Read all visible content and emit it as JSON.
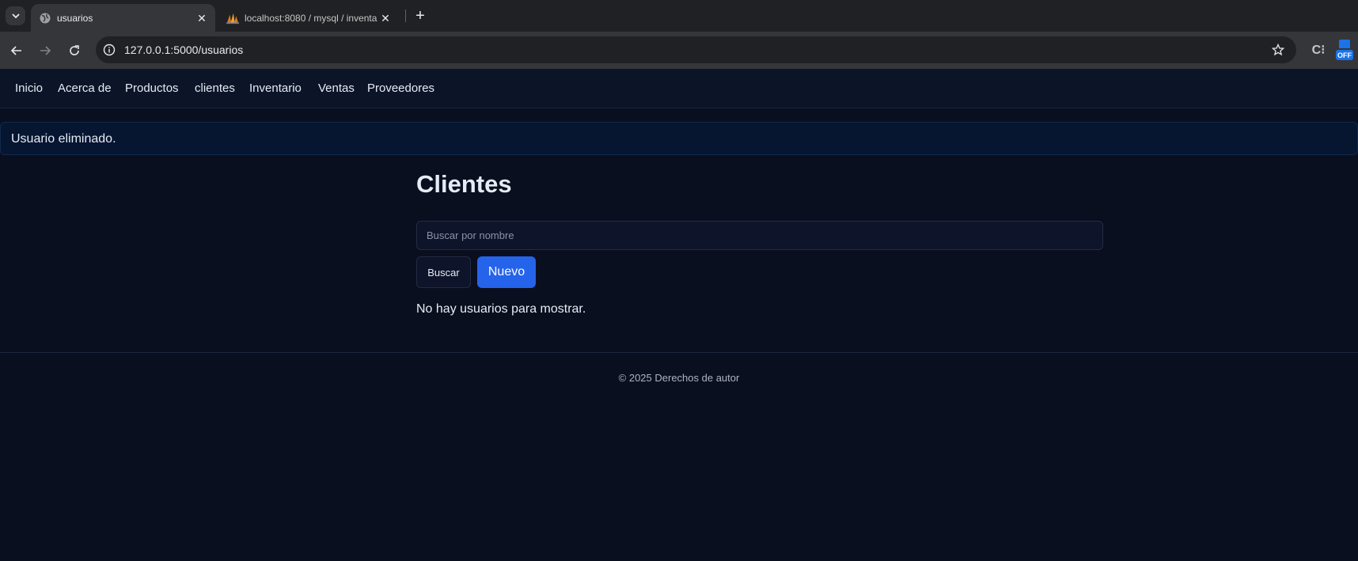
{
  "browser": {
    "tabs": [
      {
        "title": "usuarios",
        "active": true
      },
      {
        "title": "localhost:8080 / mysql / inventa",
        "active": false
      }
    ],
    "url_host": "127.0.0.1",
    "url_rest": ":5000/usuarios",
    "extension_badge": "OFF"
  },
  "nav": {
    "items": [
      "Inicio",
      "Acerca de",
      "Productos",
      "clientes",
      "Inventario",
      "Ventas",
      "Proveedores"
    ]
  },
  "flash": {
    "message": "Usuario eliminado."
  },
  "main": {
    "title": "Clientes",
    "search_placeholder": "Buscar por nombre",
    "search_value": "",
    "search_button": "Buscar",
    "new_button": "Nuevo",
    "empty_message": "No hay usuarios para mostrar."
  },
  "footer": {
    "text": "© 2025 Derechos de autor"
  },
  "colors": {
    "accent": "#2563eb",
    "background": "#0a0f1f"
  }
}
